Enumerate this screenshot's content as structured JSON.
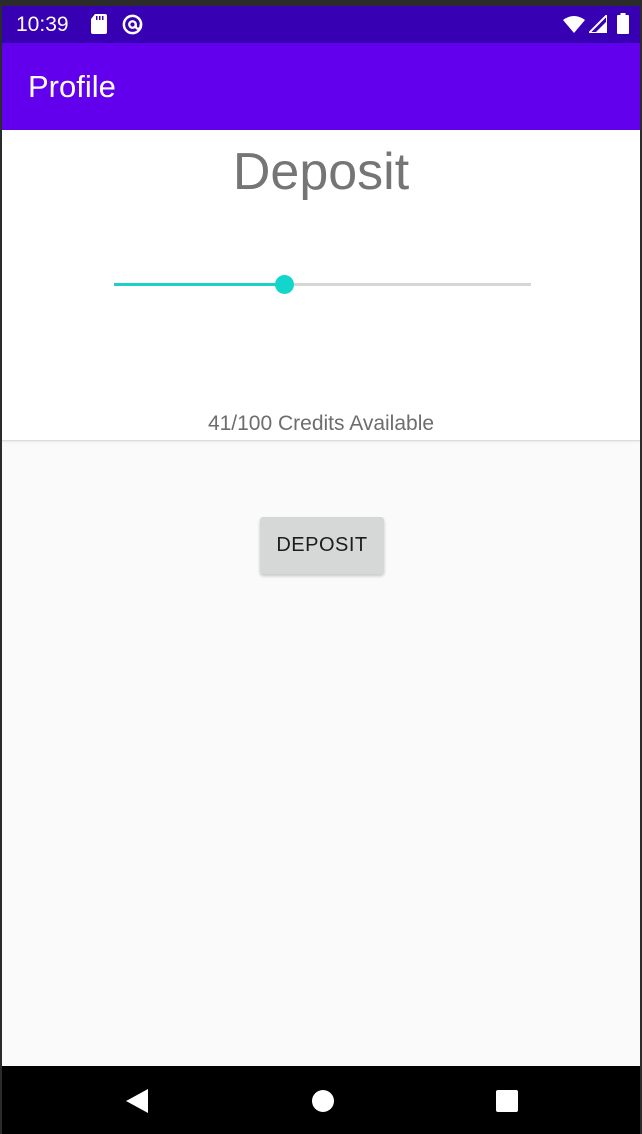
{
  "status_bar": {
    "time": "10:39",
    "icons": [
      "sd-card-icon",
      "at-sign-icon",
      "wifi-icon",
      "cellular-signal-icon",
      "battery-icon"
    ]
  },
  "app_bar": {
    "title": "Profile"
  },
  "deposit_card": {
    "title": "Deposit",
    "slider": {
      "value": 41,
      "min": 0,
      "max": 100
    },
    "credits_text": "41/100 Credits Available"
  },
  "deposit_button": {
    "label": "DEPOSIT"
  },
  "nav_bar": {
    "buttons": [
      "back-icon",
      "home-icon",
      "recents-icon"
    ]
  },
  "colors": {
    "status_bar": "#3700b3",
    "app_bar": "#6200ee",
    "slider_accent": "#12d6cb",
    "background": "#fafafa"
  }
}
